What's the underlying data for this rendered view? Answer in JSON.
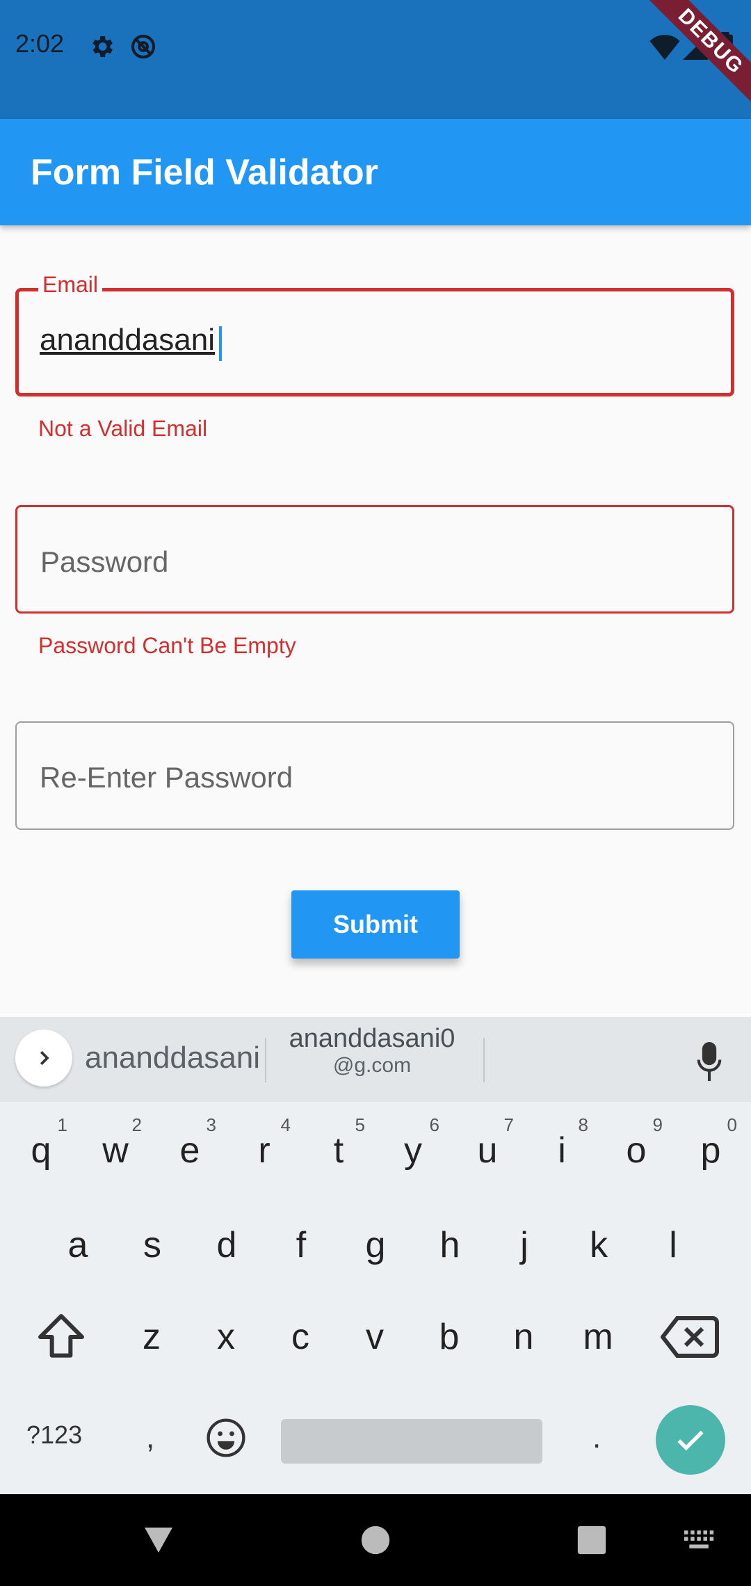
{
  "status_bar": {
    "time": "2:02"
  },
  "debug_banner": {
    "label": "DEBUG"
  },
  "app_bar": {
    "title": "Form Field Validator"
  },
  "form": {
    "email": {
      "label": "Email",
      "value": "ananddasani",
      "error": "Not a Valid Email"
    },
    "password": {
      "placeholder": "Password",
      "error": "Password Can't Be Empty"
    },
    "reenter_password": {
      "placeholder": "Re-Enter Password"
    },
    "submit_label": "Submit"
  },
  "keyboard": {
    "suggestions": {
      "primary": "ananddasani",
      "secondary_main": "ananddasani0",
      "secondary_sub": "@g.com"
    },
    "row1": [
      {
        "k": "q",
        "h": "1"
      },
      {
        "k": "w",
        "h": "2"
      },
      {
        "k": "e",
        "h": "3"
      },
      {
        "k": "r",
        "h": "4"
      },
      {
        "k": "t",
        "h": "5"
      },
      {
        "k": "y",
        "h": "6"
      },
      {
        "k": "u",
        "h": "7"
      },
      {
        "k": "i",
        "h": "8"
      },
      {
        "k": "o",
        "h": "9"
      },
      {
        "k": "p",
        "h": "0"
      }
    ],
    "row2": [
      "a",
      "s",
      "d",
      "f",
      "g",
      "h",
      "j",
      "k",
      "l"
    ],
    "row3": [
      "z",
      "x",
      "c",
      "v",
      "b",
      "n",
      "m"
    ],
    "sym_label": "?123",
    "comma": ",",
    "period": "."
  },
  "colors": {
    "status_bar": "#1a72bc",
    "app_bar": "#2196f3",
    "error": "#d32f2f",
    "done_key": "#4db6ac"
  }
}
